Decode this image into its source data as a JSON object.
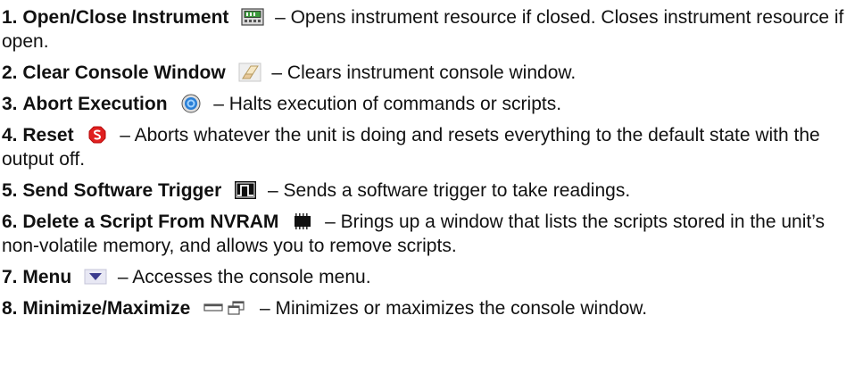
{
  "items": [
    {
      "num": "1.",
      "title": "Open/Close Instrument",
      "icon": "instrument-icon",
      "desc": "– Opens instrument resource if closed. Closes instrument resource if open."
    },
    {
      "num": "2.",
      "title": "Clear Console Window",
      "icon": "eraser-icon",
      "desc": "– Clears instrument console window."
    },
    {
      "num": "3.",
      "title": "Abort Execution",
      "icon": "abort-icon",
      "desc": "– Halts execution of commands or scripts."
    },
    {
      "num": "4.",
      "title": "Reset",
      "icon": "reset-icon",
      "desc": "– Aborts whatever the unit is doing and resets everything to the default state with the output off."
    },
    {
      "num": "5.",
      "title": "Send Software Trigger",
      "icon": "trigger-icon",
      "desc": "– Sends a software trigger to take readings."
    },
    {
      "num": "6.",
      "title": "Delete a Script From NVRAM",
      "icon": "memory-chip-icon",
      "desc": "– Brings up a window that lists the scripts stored in the unit’s non-volatile memory, and allows you to remove scripts."
    },
    {
      "num": "7.",
      "title": "Menu",
      "icon": "menu-arrow-icon",
      "desc": "– Accesses the console menu."
    },
    {
      "num": "8.",
      "title": "Minimize/Maximize",
      "icon": "minimize-maximize-icon",
      "desc": "– Minimizes or maximizes the console window."
    }
  ],
  "colors": {
    "text": "#111111",
    "reset_red": "#e02020",
    "abort_blue": "#2a7fd6"
  }
}
